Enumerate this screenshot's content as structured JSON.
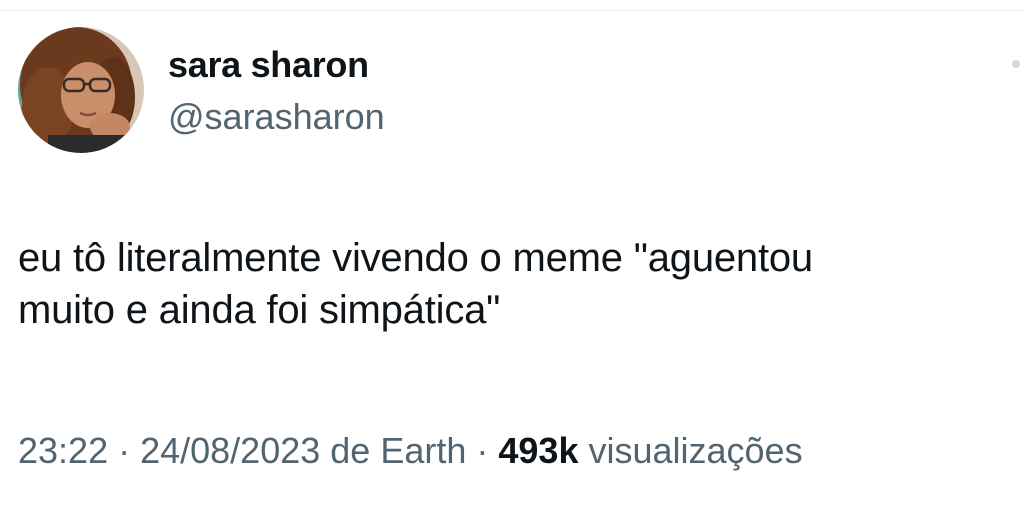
{
  "author": {
    "display_name": "sara sharon",
    "handle": "@sarasharon"
  },
  "tweet": {
    "text_lines": [
      "eu tô literalmente vivendo o meme \"aguentou",
      "muito e ainda foi simpática\""
    ]
  },
  "meta": {
    "time": "23:22",
    "separator_1": " · ",
    "date": "24/08/2023",
    "source_prefix": " de ",
    "source": "Earth",
    "separator_2": " · ",
    "views_count": "493k",
    "views_label": " visualizações"
  },
  "icons": {
    "avatar": "profile-photo",
    "more": "more-options-icon"
  },
  "colors": {
    "text_primary": "#0f1419",
    "text_secondary": "#536471",
    "background": "#ffffff"
  }
}
